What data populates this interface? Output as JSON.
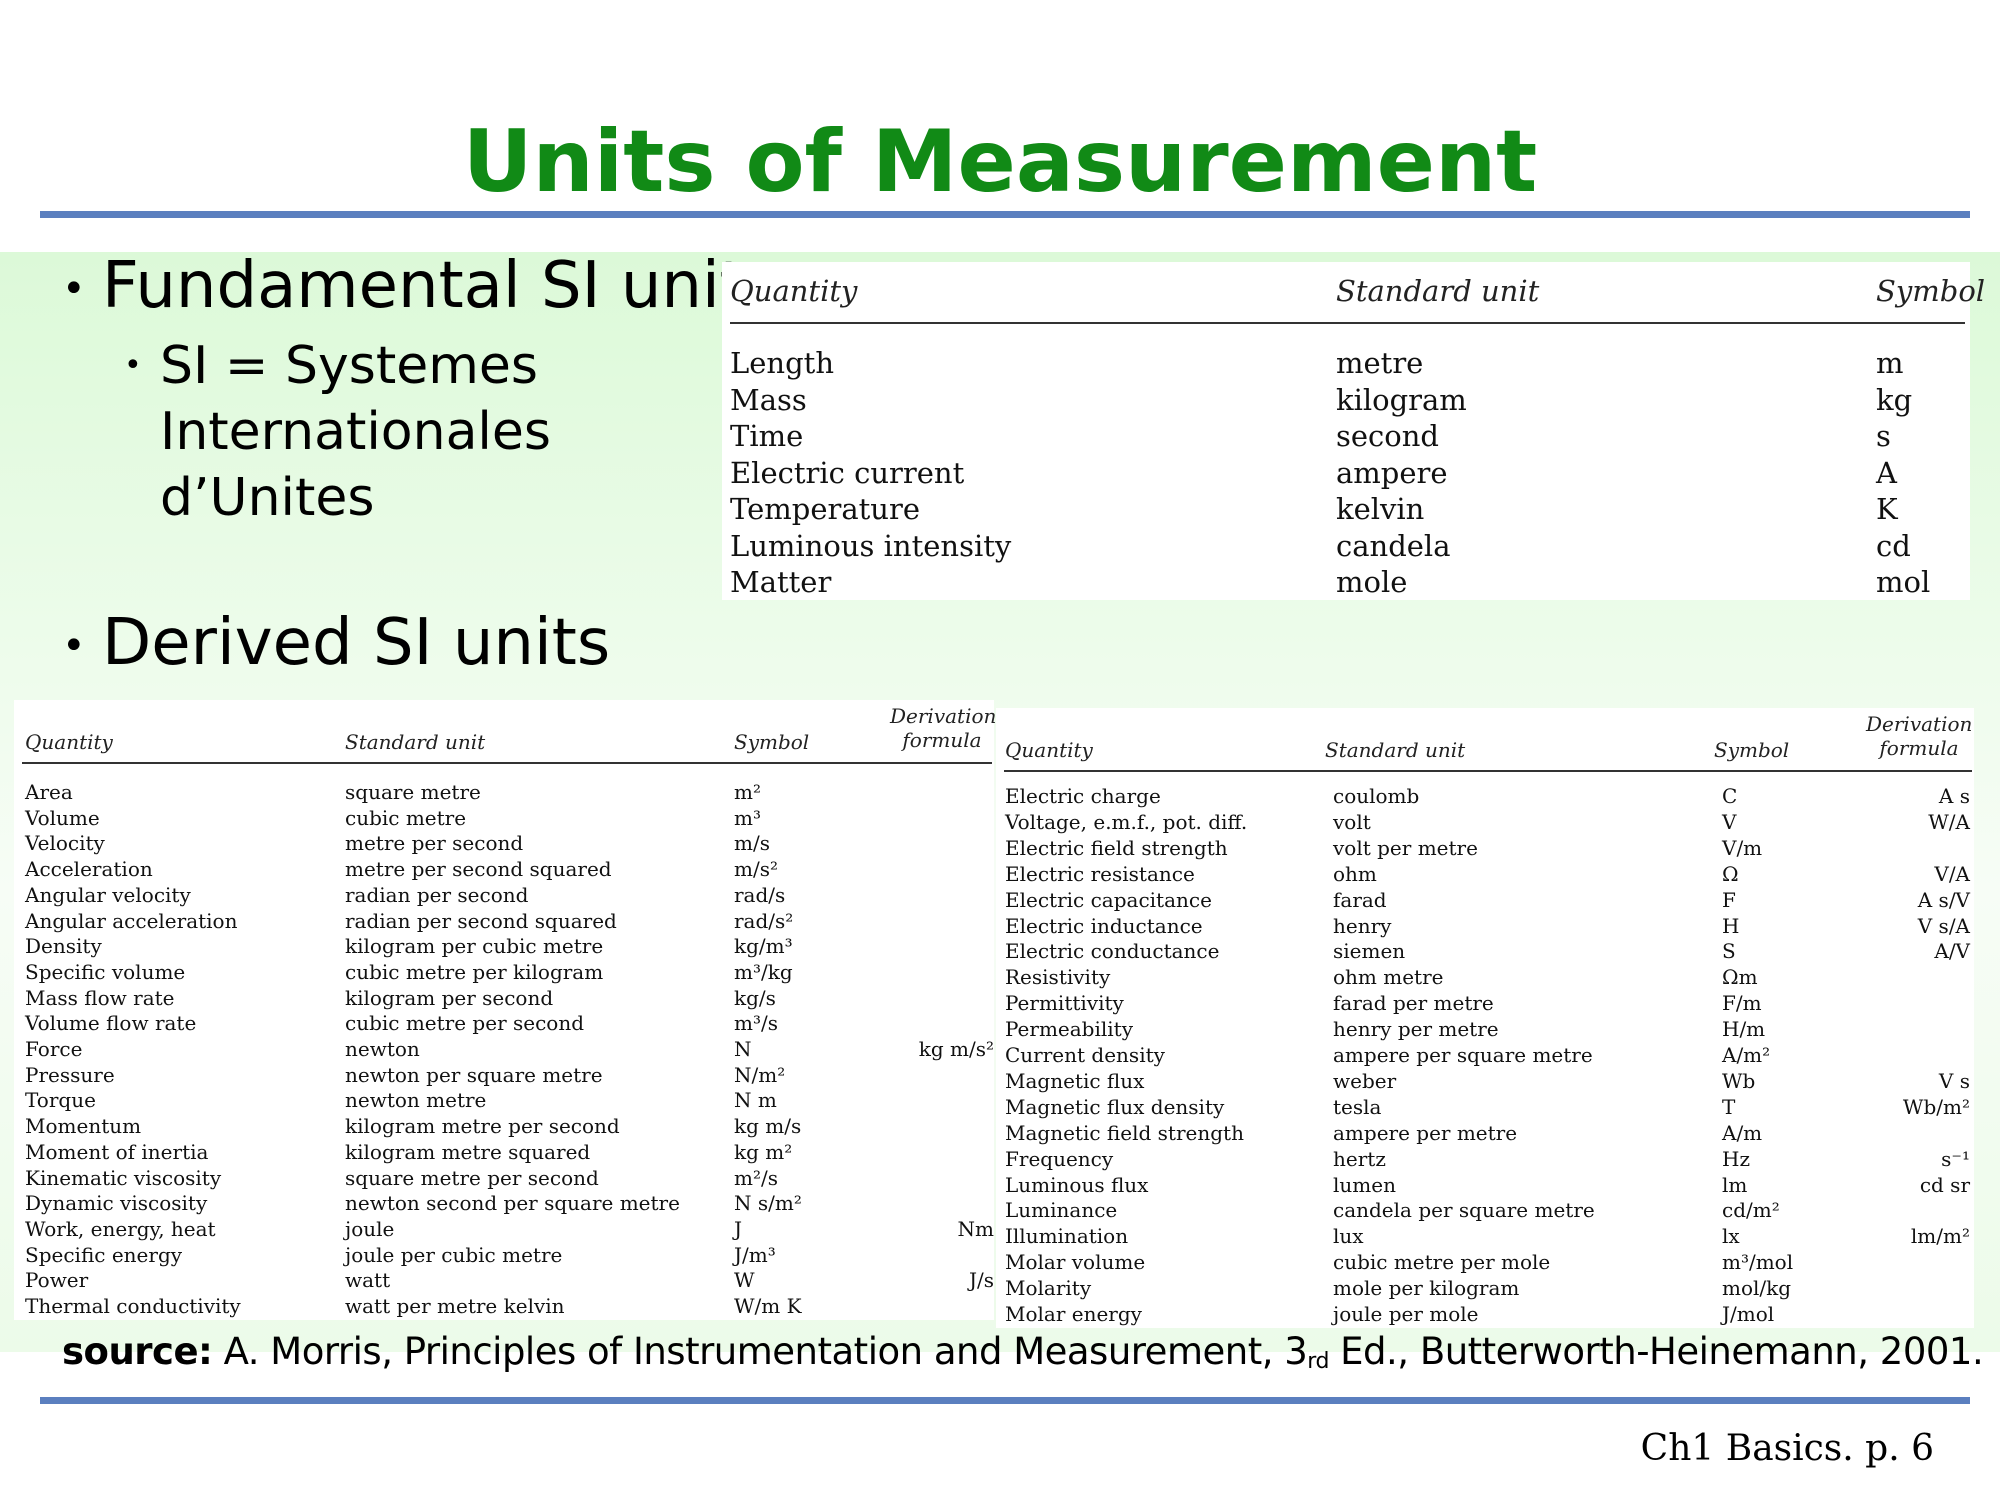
{
  "slide": {
    "title": "Units of Measurement",
    "footer": "Ch1 Basics. p. 6"
  },
  "bullets": {
    "fundamental": "Fundamental SI units",
    "si_definition_lines": [
      "SI = Systemes",
      "Internationales",
      "d’Unites"
    ],
    "derived": "Derived SI units"
  },
  "fundamental_table": {
    "headers": {
      "quantity": "Quantity",
      "unit": "Standard unit",
      "symbol": "Symbol"
    },
    "rows": [
      {
        "quantity": "Length",
        "unit": "metre",
        "symbol": "m"
      },
      {
        "quantity": "Mass",
        "unit": "kilogram",
        "symbol": "kg"
      },
      {
        "quantity": "Time",
        "unit": "second",
        "symbol": "s"
      },
      {
        "quantity": "Electric current",
        "unit": "ampere",
        "symbol": "A"
      },
      {
        "quantity": "Temperature",
        "unit": "kelvin",
        "symbol": "K"
      },
      {
        "quantity": "Luminous intensity",
        "unit": "candela",
        "symbol": "cd"
      },
      {
        "quantity": "Matter",
        "unit": "mole",
        "symbol": "mol"
      }
    ]
  },
  "derived_tables": {
    "headers": {
      "quantity": "Quantity",
      "unit": "Standard unit",
      "symbol": "Symbol",
      "derivation_line1": "Derivation",
      "derivation_line2": "formula"
    },
    "left_rows": [
      {
        "quantity": "Area",
        "unit": "square metre",
        "symbol": "m²",
        "formula": ""
      },
      {
        "quantity": "Volume",
        "unit": "cubic metre",
        "symbol": "m³",
        "formula": ""
      },
      {
        "quantity": "Velocity",
        "unit": "metre per second",
        "symbol": "m/s",
        "formula": ""
      },
      {
        "quantity": "Acceleration",
        "unit": "metre per second squared",
        "symbol": "m/s²",
        "formula": ""
      },
      {
        "quantity": "Angular velocity",
        "unit": "radian per second",
        "symbol": "rad/s",
        "formula": ""
      },
      {
        "quantity": "Angular acceleration",
        "unit": "radian per second squared",
        "symbol": "rad/s²",
        "formula": ""
      },
      {
        "quantity": "Density",
        "unit": "kilogram per cubic metre",
        "symbol": "kg/m³",
        "formula": ""
      },
      {
        "quantity": "Specific volume",
        "unit": "cubic metre per kilogram",
        "symbol": "m³/kg",
        "formula": ""
      },
      {
        "quantity": "Mass flow rate",
        "unit": "kilogram per second",
        "symbol": "kg/s",
        "formula": ""
      },
      {
        "quantity": "Volume flow rate",
        "unit": "cubic metre per second",
        "symbol": "m³/s",
        "formula": ""
      },
      {
        "quantity": "Force",
        "unit": "newton",
        "symbol": "N",
        "formula": "kg m/s²"
      },
      {
        "quantity": "Pressure",
        "unit": "newton per square metre",
        "symbol": "N/m²",
        "formula": ""
      },
      {
        "quantity": "Torque",
        "unit": "newton metre",
        "symbol": "N m",
        "formula": ""
      },
      {
        "quantity": "Momentum",
        "unit": "kilogram metre per second",
        "symbol": "kg m/s",
        "formula": ""
      },
      {
        "quantity": "Moment of inertia",
        "unit": "kilogram metre squared",
        "symbol": "kg m²",
        "formula": ""
      },
      {
        "quantity": "Kinematic viscosity",
        "unit": "square metre per second",
        "symbol": "m²/s",
        "formula": ""
      },
      {
        "quantity": "Dynamic viscosity",
        "unit": "newton second per square metre",
        "symbol": "N s/m²",
        "formula": ""
      },
      {
        "quantity": "Work, energy, heat",
        "unit": "joule",
        "symbol": "J",
        "formula": "Nm"
      },
      {
        "quantity": "Specific energy",
        "unit": "joule per cubic metre",
        "symbol": "J/m³",
        "formula": ""
      },
      {
        "quantity": "Power",
        "unit": "watt",
        "symbol": "W",
        "formula": "J/s"
      },
      {
        "quantity": "Thermal conductivity",
        "unit": "watt per metre kelvin",
        "symbol": "W/m K",
        "formula": ""
      }
    ],
    "right_rows": [
      {
        "quantity": "Electric charge",
        "unit": "coulomb",
        "symbol": "C",
        "formula": "A s"
      },
      {
        "quantity": "Voltage, e.m.f., pot. diff.",
        "unit": "volt",
        "symbol": "V",
        "formula": "W/A"
      },
      {
        "quantity": "Electric field strength",
        "unit": "volt per metre",
        "symbol": "V/m",
        "formula": ""
      },
      {
        "quantity": "Electric resistance",
        "unit": "ohm",
        "symbol": "Ω",
        "formula": "V/A"
      },
      {
        "quantity": "Electric capacitance",
        "unit": "farad",
        "symbol": "F",
        "formula": "A s/V"
      },
      {
        "quantity": "Electric inductance",
        "unit": "henry",
        "symbol": "H",
        "formula": "V s/A"
      },
      {
        "quantity": "Electric conductance",
        "unit": "siemen",
        "symbol": "S",
        "formula": "A/V"
      },
      {
        "quantity": "Resistivity",
        "unit": "ohm metre",
        "symbol": "Ωm",
        "formula": ""
      },
      {
        "quantity": "Permittivity",
        "unit": "farad per metre",
        "symbol": "F/m",
        "formula": ""
      },
      {
        "quantity": "Permeability",
        "unit": "henry per metre",
        "symbol": "H/m",
        "formula": ""
      },
      {
        "quantity": "Current density",
        "unit": "ampere per square metre",
        "symbol": "A/m²",
        "formula": ""
      },
      {
        "quantity": "Magnetic flux",
        "unit": "weber",
        "symbol": "Wb",
        "formula": "V s"
      },
      {
        "quantity": "Magnetic flux density",
        "unit": "tesla",
        "symbol": "T",
        "formula": "Wb/m²"
      },
      {
        "quantity": "Magnetic field strength",
        "unit": "ampere per metre",
        "symbol": "A/m",
        "formula": ""
      },
      {
        "quantity": "Frequency",
        "unit": "hertz",
        "symbol": "Hz",
        "formula": "s⁻¹"
      },
      {
        "quantity": "Luminous flux",
        "unit": "lumen",
        "symbol": "lm",
        "formula": "cd sr"
      },
      {
        "quantity": "Luminance",
        "unit": "candela per square metre",
        "symbol": "cd/m²",
        "formula": ""
      },
      {
        "quantity": "Illumination",
        "unit": "lux",
        "symbol": "lx",
        "formula": "lm/m²"
      },
      {
        "quantity": "Molar volume",
        "unit": "cubic metre per mole",
        "symbol": "m³/mol",
        "formula": ""
      },
      {
        "quantity": "Molarity",
        "unit": "mole per kilogram",
        "symbol": "mol/kg",
        "formula": ""
      },
      {
        "quantity": "Molar energy",
        "unit": "joule per mole",
        "symbol": "J/mol",
        "formula": ""
      }
    ]
  },
  "source": {
    "label": "source:",
    "text_before_ordinal": "A. Morris, Principles of Instrumentation and Measurement, 3",
    "ordinal_suffix": "rd",
    "text_after_ordinal": " Ed., Butterworth-Heinemann, 2001."
  },
  "colors": {
    "title": "#118a16",
    "rule": "#5b7fbf",
    "background_glow": "#dcf9d8"
  }
}
